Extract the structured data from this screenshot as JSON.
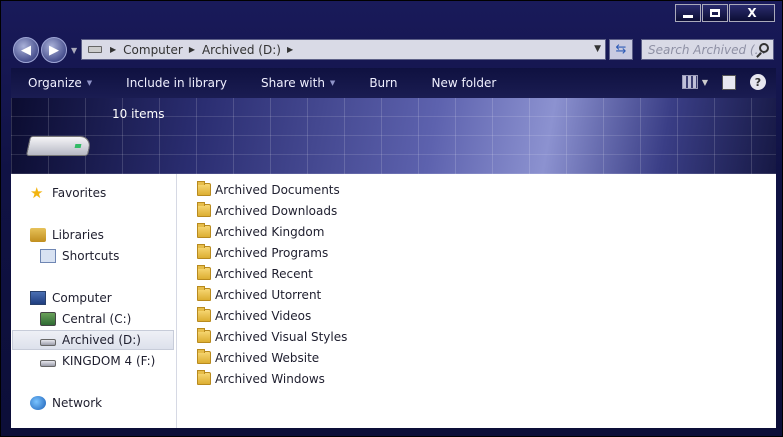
{
  "window": {
    "caption": {
      "minimize": "",
      "maximize": "",
      "close": "X"
    }
  },
  "nav": {
    "back_glyph": "◀",
    "forward_glyph": "▶"
  },
  "address": {
    "crumbs": [
      "Computer",
      "Archived (D:)"
    ]
  },
  "search": {
    "placeholder": "Search Archived (..."
  },
  "toolbar": {
    "organize": "Organize",
    "include_in_library": "Include in library",
    "share_with": "Share with",
    "burn": "Burn",
    "new_folder": "New folder"
  },
  "banner": {
    "item_count": "10 items"
  },
  "sidebar": {
    "favorites": "Favorites",
    "libraries": "Libraries",
    "shortcuts": "Shortcuts",
    "computer": "Computer",
    "drives": [
      "Central (C:)",
      "Archived (D:)",
      "KINGDOM 4 (F:)"
    ],
    "network": "Network"
  },
  "files": [
    "Archived Documents",
    "Archived Downloads",
    "Archived Kingdom",
    "Archived Programs",
    "Archived Recent",
    "Archived Utorrent",
    "Archived Videos",
    "Archived Visual Styles",
    "Archived Website",
    "Archived Windows"
  ],
  "icons": {
    "favorites": "star-icon",
    "libraries": "library-icon",
    "shortcuts": "shortcut-icon",
    "computer": "computer-icon",
    "drive": "drive-icon",
    "network": "network-icon",
    "folder": "folder-icon"
  }
}
